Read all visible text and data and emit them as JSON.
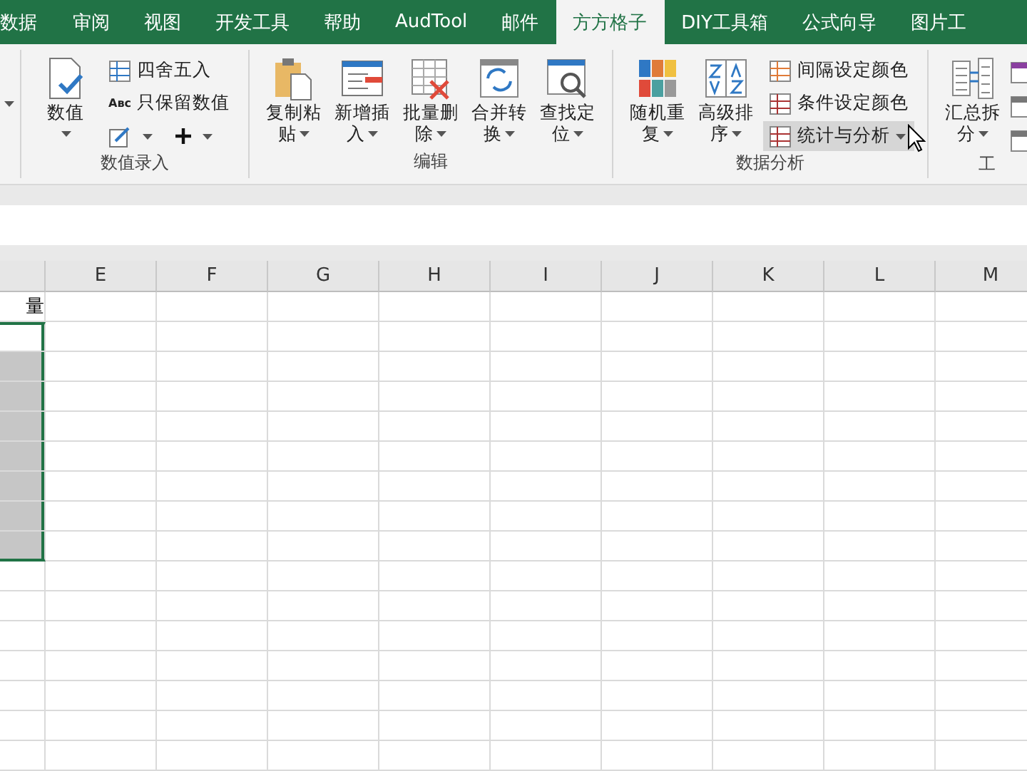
{
  "tabs": [
    {
      "label": "数据",
      "selected": false
    },
    {
      "label": "审阅",
      "selected": false
    },
    {
      "label": "视图",
      "selected": false
    },
    {
      "label": "开发工具",
      "selected": false
    },
    {
      "label": "帮助",
      "selected": false
    },
    {
      "label": "AudTool",
      "selected": false
    },
    {
      "label": "邮件",
      "selected": false
    },
    {
      "label": "方方格子",
      "selected": true
    },
    {
      "label": "DIY工具箱",
      "selected": false
    },
    {
      "label": "公式向导",
      "selected": false
    },
    {
      "label": "图片工",
      "selected": false
    }
  ],
  "ribbon": {
    "groups": [
      {
        "label": "数值录入",
        "columns": [
          {
            "kind": "large",
            "lines": [
              "数值"
            ],
            "dropdown": true
          },
          {
            "kind": "stack",
            "items": [
              {
                "label": "四舍五入",
                "highlighted": false
              },
              {
                "label": "只保留数值",
                "icon_text": "Aʙc",
                "highlighted": false
              },
              {
                "kind": "icons",
                "dropdown": true
              }
            ]
          }
        ]
      },
      {
        "label": "编辑",
        "columns": [
          {
            "kind": "large",
            "lines": [
              "复制粘",
              "贴"
            ],
            "dropdown": true
          },
          {
            "kind": "large",
            "lines": [
              "新增插",
              "入"
            ],
            "dropdown": true
          },
          {
            "kind": "large",
            "lines": [
              "批量删",
              "除"
            ],
            "dropdown": true
          },
          {
            "kind": "large",
            "lines": [
              "合并转",
              "换"
            ],
            "dropdown": true
          },
          {
            "kind": "large",
            "lines": [
              "查找定",
              "位"
            ],
            "dropdown": true
          }
        ]
      },
      {
        "label": "数据分析",
        "columns": [
          {
            "kind": "large",
            "lines": [
              "随机重",
              "复"
            ],
            "dropdown": true
          },
          {
            "kind": "large",
            "lines": [
              "高级排",
              "序"
            ],
            "dropdown": true
          },
          {
            "kind": "stack",
            "items": [
              {
                "label": "间隔设定颜色",
                "highlighted": false
              },
              {
                "label": "条件设定颜色",
                "highlighted": false
              },
              {
                "label": "统计与分析",
                "highlighted": true,
                "dropdown": true
              }
            ]
          }
        ]
      },
      {
        "label": "工",
        "columns": [
          {
            "kind": "large",
            "lines": [
              "汇总拆",
              "分"
            ],
            "dropdown": true
          },
          {
            "kind": "icon_stack"
          }
        ]
      }
    ]
  },
  "sheet": {
    "columns": [
      "E",
      "F",
      "G",
      "H",
      "I",
      "J",
      "K",
      "L",
      "M"
    ],
    "partial_column": {
      "cells": [
        {
          "text": "量",
          "selected": false,
          "active": false
        },
        {
          "selected": true,
          "active": true
        },
        {
          "selected": true,
          "active": false
        },
        {
          "selected": true,
          "active": false
        },
        {
          "selected": true,
          "active": false
        },
        {
          "selected": true,
          "active": false
        },
        {
          "selected": true,
          "active": false
        },
        {
          "selected": true,
          "active": false
        },
        {
          "selected": true,
          "active": false
        }
      ]
    }
  }
}
